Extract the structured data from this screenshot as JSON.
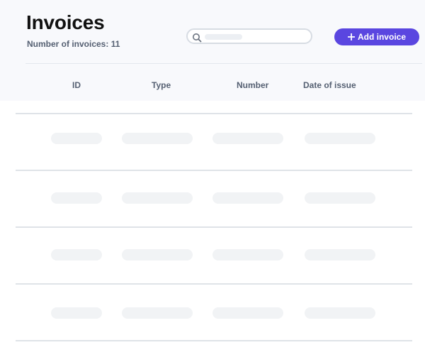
{
  "header": {
    "title": "Invoices",
    "subtitle": "Number of invoices: 11"
  },
  "search": {
    "icon": "search-icon",
    "placeholder": ""
  },
  "actions": {
    "add_label": "Add invoice",
    "add_icon": "plus-icon",
    "accent_color": "#5a46e0"
  },
  "table": {
    "columns": [
      "ID",
      "Type",
      "Number",
      "Date of issue"
    ],
    "rows_loading": 4
  }
}
